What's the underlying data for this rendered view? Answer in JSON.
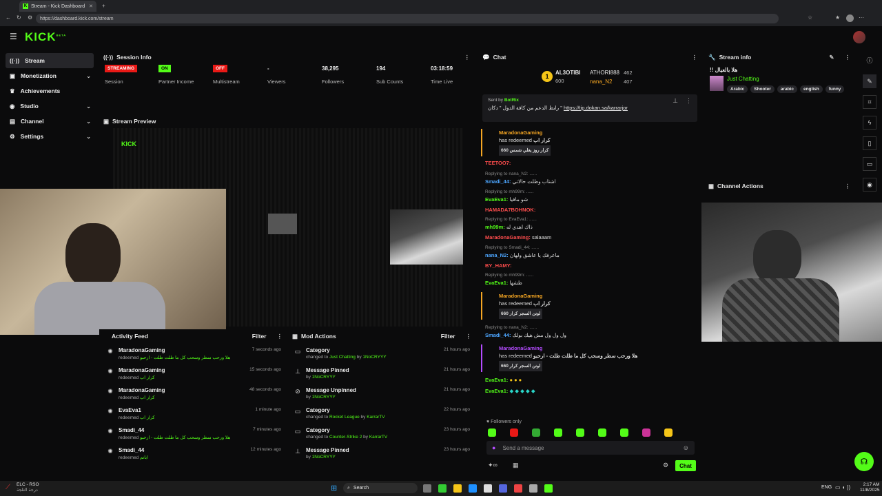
{
  "browser": {
    "tab_title": "Stream - Kick Dashboard",
    "url": "https://dashboard.kick.com/stream"
  },
  "app": {
    "logo": "KICK",
    "logo_beta": "BETA"
  },
  "sidebar": {
    "items": [
      {
        "label": "Stream",
        "icon": "broadcast-icon"
      },
      {
        "label": "Monetization",
        "icon": "money-icon"
      },
      {
        "label": "Achievements",
        "icon": "trophy-icon"
      },
      {
        "label": "Studio",
        "icon": "studio-icon"
      },
      {
        "label": "Channel",
        "icon": "channel-icon"
      },
      {
        "label": "Settings",
        "icon": "gear-icon"
      }
    ]
  },
  "session": {
    "title": "Session Info",
    "stats": [
      {
        "badge": "STREAMING",
        "label": "Session"
      },
      {
        "badge": "ON",
        "label": "Partner Income"
      },
      {
        "badge": "OFF",
        "label": "Multistream"
      },
      {
        "value": "-",
        "label": "Viewers"
      },
      {
        "value": "38,295",
        "label": "Followers"
      },
      {
        "value": "194",
        "label": "Sub Counts"
      },
      {
        "value": "03:18:59",
        "label": "Time Live"
      }
    ]
  },
  "preview": {
    "title": "Stream Preview"
  },
  "activity": {
    "title": "Activity Feed",
    "filter": "Filter",
    "items": [
      {
        "name": "MaradonaGaming",
        "action": "redeemed",
        "reward": "هلا ورحب سطر وسحب كل ما طلت طلت - ارحبو",
        "time": "7 seconds ago"
      },
      {
        "name": "MaradonaGaming",
        "action": "redeemed",
        "reward": "كرار اب",
        "time": "15 seconds ago"
      },
      {
        "name": "MaradonaGaming",
        "action": "redeemed",
        "reward": "كرار اب",
        "time": "48 seconds ago"
      },
      {
        "name": "EvaEva1",
        "action": "redeemed",
        "reward": "كرار اب",
        "time": "1 minute ago"
      },
      {
        "name": "Smadi_44",
        "action": "redeemed",
        "reward": "هلا ورحب سطر وسحب كل ما طلت طلت - ارحبو",
        "time": "7 minutes ago"
      },
      {
        "name": "Smadi_44",
        "action": "redeemed",
        "reward": "اباتم",
        "time": "12 minutes ago"
      }
    ]
  },
  "mod": {
    "title": "Mod Actions",
    "filter": "Filter",
    "items": [
      {
        "title": "Category",
        "sub": "changed to",
        "hl": "Just Chatting",
        "by": "by",
        "user": "1NoCRYYY",
        "time": "21 hours ago"
      },
      {
        "title": "Message Pinned",
        "sub": "",
        "hl": "",
        "by": "by",
        "user": "1NoCRYYY",
        "time": "21 hours ago"
      },
      {
        "title": "Message Unpinned",
        "sub": "",
        "hl": "",
        "by": "by",
        "user": "1NoCRYYY",
        "time": "21 hours ago"
      },
      {
        "title": "Category",
        "sub": "changed to",
        "hl": "Rocket League",
        "by": "by",
        "user": "KarrarTV",
        "time": "22 hours ago"
      },
      {
        "title": "Category",
        "sub": "changed to",
        "hl": "Counter-Strike 2",
        "by": "by",
        "user": "KarrarTV",
        "time": "23 hours ago"
      },
      {
        "title": "Message Pinned",
        "sub": "",
        "hl": "",
        "by": "by",
        "user": "1NoCRYYY",
        "time": "23 hours ago"
      }
    ]
  },
  "chat": {
    "title": "Chat",
    "top": [
      {
        "rank": "1",
        "name": "AL3OTIBI",
        "count": "600"
      },
      {
        "name": "ATHORI888",
        "count": "462"
      },
      {
        "name": "nana_N2",
        "count": "407"
      }
    ],
    "pinned": {
      "sent_by": "Sent by",
      "bot": "BotRix",
      "text": "رابط الدعم من كافة الدول \" دكان \"",
      "link": "https://tip.dokan.sa/karrarjor"
    },
    "messages": [
      {
        "type": "redeem",
        "user": "MaradonaGaming",
        "has": "has redeemed",
        "reward": "كرار اب",
        "chip": "كرار روز يغلي شمس 660"
      },
      {
        "type": "msg",
        "user": "TEETOO7:",
        "text": ""
      },
      {
        "type": "msg",
        "reply": "Replying to nana_N2: ......",
        "user": "Smadi_44:",
        "text": "اشتاب وطلت حالاتي"
      },
      {
        "type": "msg",
        "reply": "Replying to mh99m: ......",
        "user": "EvaEva1:",
        "text": "شو مافيا"
      },
      {
        "type": "msg",
        "user": "HAMADA7BOHNOK:",
        "text": ""
      },
      {
        "type": "msg",
        "reply": "Replying to EvaEva1: ......",
        "user": "mh99m:",
        "text": "ذاك اهدي له"
      },
      {
        "type": "msg",
        "user": "MaradonaGaming:",
        "text": "salaaam"
      },
      {
        "type": "msg",
        "reply": "Replying to Smadi_44: ......",
        "user": "nana_N2:",
        "text": "ماعرفك يا عاشق ولهان"
      },
      {
        "type": "msg",
        "user": "BY_HAMY:",
        "text": ""
      },
      {
        "type": "msg",
        "reply": "Replying to mh99m: ......",
        "user": "EvaEva1:",
        "text": "طشها"
      },
      {
        "type": "redeem",
        "user": "MaradonaGaming",
        "has": "has redeemed",
        "reward": "كرار اب",
        "chip": "لونن السجر كرار 660"
      },
      {
        "type": "msg",
        "reply": "Replying to nana_N2: ......",
        "user": "Smadi_44:",
        "text": "ول ول ول مش هيك بولك"
      },
      {
        "type": "redeem2",
        "user": "MaradonaGaming",
        "has": "has redeemed",
        "reward": "هلا ورحب سطر وسحب كل ما طلت طلت - ارحبو",
        "chip": "لونن السجر كرار 660"
      },
      {
        "type": "msg",
        "user": "EvaEva1:",
        "text": ""
      },
      {
        "type": "msg",
        "user": "EvaEva1:",
        "text": ""
      }
    ],
    "followers_only": "Followers only",
    "placeholder": "Send a message",
    "send": "Chat"
  },
  "stream_info": {
    "title": "Stream info",
    "stream_title": "!! هلا بالعيال",
    "category": "Just Chatting",
    "tags": [
      "Arabic",
      "Shooter",
      "arabic",
      "english",
      "funny"
    ]
  },
  "channel_actions": {
    "title": "Channel Actions"
  },
  "taskbar": {
    "weather_temp": "ELC - RSO",
    "weather_sub": "درجة الثلجة",
    "search": "Search",
    "lang": "ENG",
    "time": "2:17 AM",
    "date": "11/8/2025"
  },
  "colors": {
    "accent": "#53fc18",
    "bg": "#0b0b0c",
    "red": "#e91916"
  }
}
